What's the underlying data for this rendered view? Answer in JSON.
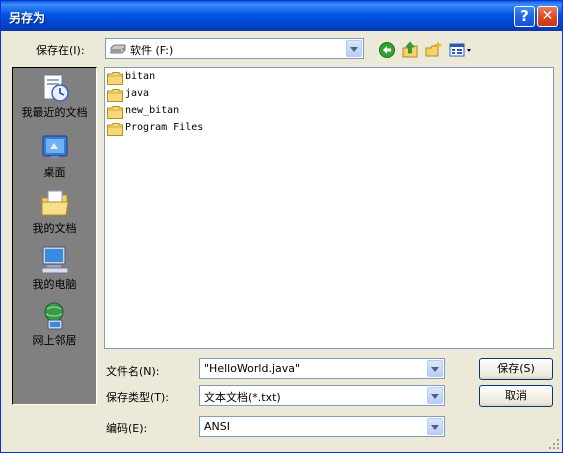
{
  "titlebar": {
    "title": "另存为",
    "help_symbol": "?",
    "close_symbol": "✕"
  },
  "save_in": {
    "label": "保存在(I):",
    "value": "软件 (F:)",
    "icon": "drive-icon"
  },
  "toolbar": {
    "icons": [
      "back-icon",
      "up-folder-icon",
      "new-folder-icon",
      "views-menu-icon"
    ]
  },
  "places": [
    {
      "label": "我最近的文档",
      "icon": "recent-documents-icon"
    },
    {
      "label": "桌面",
      "icon": "desktop-icon"
    },
    {
      "label": "我的文档",
      "icon": "my-documents-icon"
    },
    {
      "label": "我的电脑",
      "icon": "my-computer-icon"
    },
    {
      "label": "网上邻居",
      "icon": "network-places-icon"
    }
  ],
  "files": [
    {
      "name": "bitan",
      "icon": "folder-icon"
    },
    {
      "name": "java",
      "icon": "folder-icon"
    },
    {
      "name": "new_bitan",
      "icon": "folder-icon"
    },
    {
      "name": "Program Files",
      "icon": "folder-icon"
    }
  ],
  "filename": {
    "label": "文件名(N):",
    "value": "\"HelloWorld.java\""
  },
  "filetype": {
    "label": "保存类型(T):",
    "value": "文本文档(*.txt)"
  },
  "encoding": {
    "label": "编码(E):",
    "value": "ANSI"
  },
  "buttons": {
    "save": "保存(S)",
    "cancel": "取消"
  },
  "colors": {
    "title_bar": "#0054e3",
    "dialog_bg": "#ece9d8",
    "places_bg": "#808080"
  }
}
